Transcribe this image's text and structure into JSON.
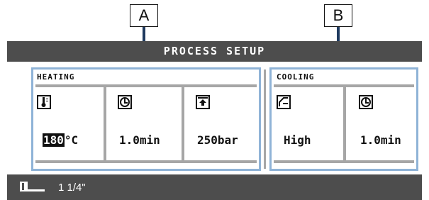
{
  "callouts": {
    "a": "A",
    "b": "B"
  },
  "title": "PROCESS SETUP",
  "heating": {
    "label": "HEATING",
    "temperature": {
      "value": "180",
      "unit": "°C",
      "icon": "thermometer-icon"
    },
    "time": {
      "value": "1.0min",
      "icon": "clock-icon"
    },
    "pressure": {
      "value": "250bar",
      "icon": "pressure-icon"
    }
  },
  "cooling": {
    "label": "COOLING",
    "fan": {
      "value": "High",
      "icon": "fan-icon"
    },
    "time": {
      "value": "1.0min",
      "icon": "clock-icon"
    }
  },
  "footer": {
    "size": "1 1/4\"",
    "icon": "pipe-size-icon"
  },
  "colors": {
    "bar": "#4d4d4d",
    "group_border": "#8fb3d7",
    "divider": "#a6a6a6",
    "arrow": "#1f3a5f"
  }
}
